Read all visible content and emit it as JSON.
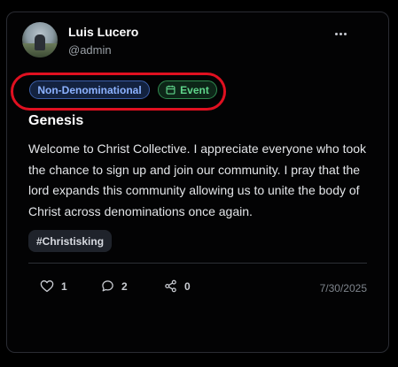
{
  "post": {
    "author": {
      "name": "Luis Lucero",
      "handle": "@admin"
    },
    "tags": [
      {
        "label": "Non-Denominational",
        "color": "#8cb2ff"
      },
      {
        "label": "Event",
        "icon": "calendar-icon",
        "color": "#5fd48a"
      }
    ],
    "title": "Genesis",
    "body": "Welcome to Christ Collective. I appreciate everyone who took the chance to sign up and join our community. I pray that the lord expands this community allowing us to unite the body of Christ across denominations once again.",
    "hashtags": [
      "#Christisking"
    ],
    "stats": {
      "likes": "1",
      "comments": "2",
      "shares": "0"
    },
    "date": "7/30/2025",
    "icons": {
      "like": "heart-icon",
      "comment": "comment-icon",
      "share": "share-icon",
      "menu": "more-icon"
    }
  },
  "colors": {
    "annotation": "#e01020",
    "background": "#030304"
  }
}
